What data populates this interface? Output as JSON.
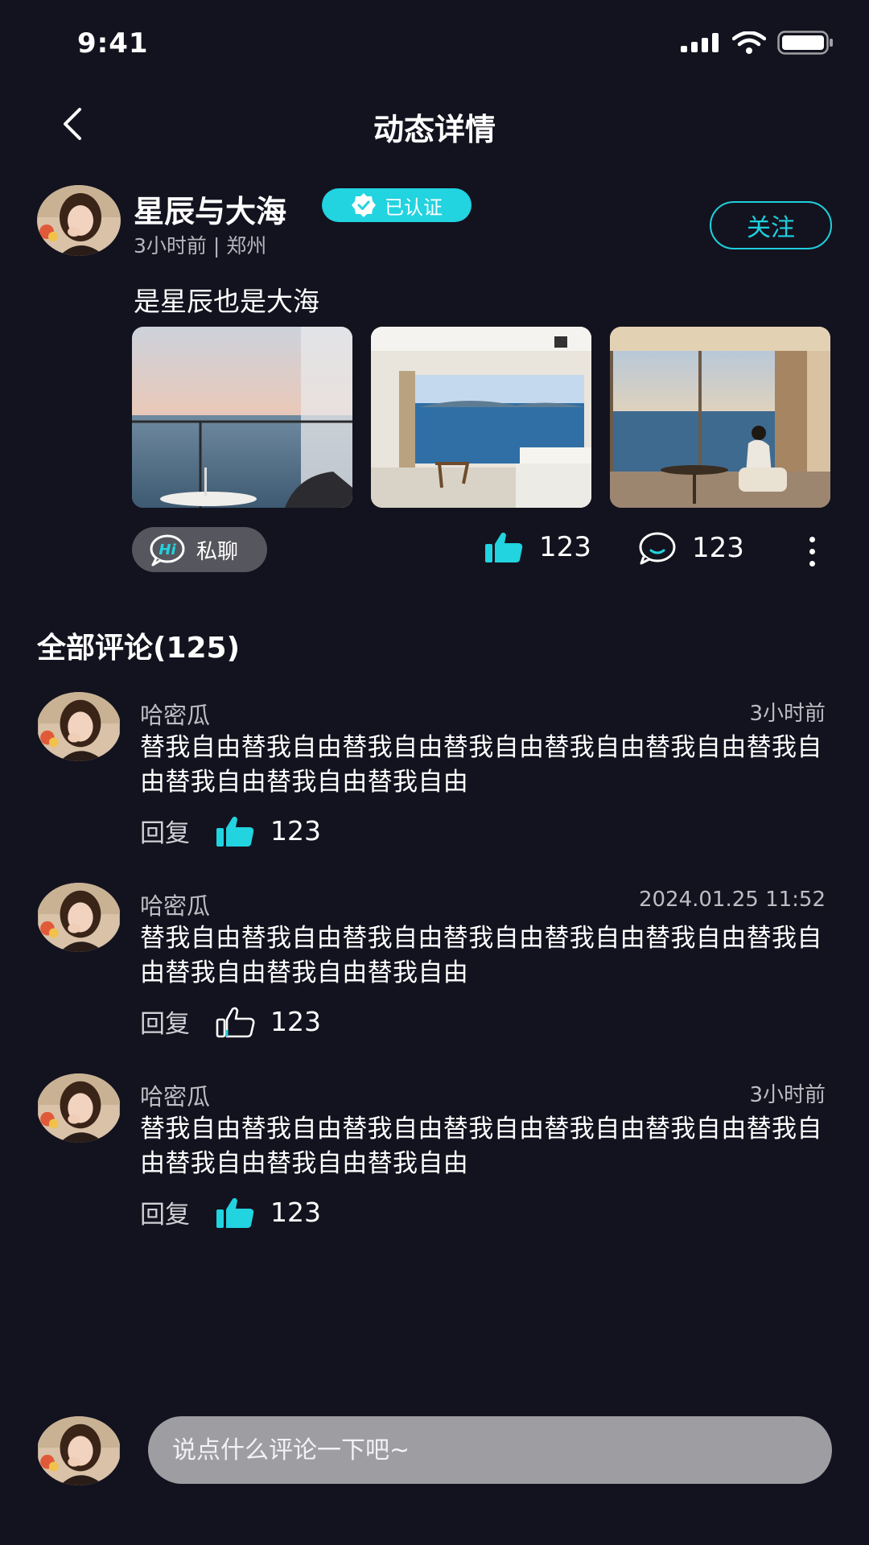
{
  "status_bar": {
    "time": "9:41"
  },
  "nav": {
    "title": "动态详情"
  },
  "post": {
    "author": "星辰与大海",
    "verified_label": "已认证",
    "meta": "3小时前 | 郑州",
    "follow_label": "关注",
    "text": "是星辰也是大海",
    "private_chat_label": "私聊",
    "like_count": "123",
    "comment_count": "123"
  },
  "comments_section": {
    "heading": "全部评论(125)",
    "comments": [
      {
        "author": "哈密瓜",
        "time": "3小时前",
        "text": "替我自由替我自由替我自由替我自由替我自由替我自由替我自由替我自由替我自由替我自由",
        "reply_label": "回复",
        "like_count": "123",
        "liked": true
      },
      {
        "author": "哈密瓜",
        "time": "2024.01.25 11:52",
        "text": "替我自由替我自由替我自由替我自由替我自由替我自由替我自由替我自由替我自由替我自由",
        "reply_label": "回复",
        "like_count": "123",
        "liked": false
      },
      {
        "author": "哈密瓜",
        "time": "3小时前",
        "text": "替我自由替我自由替我自由替我自由替我自由替我自由替我自由替我自由替我自由替我自由",
        "reply_label": "回复",
        "like_count": "123",
        "liked": true
      }
    ]
  },
  "composer": {
    "placeholder": "说点什么评论一下吧~"
  },
  "colors": {
    "background": "#13131f",
    "accent": "#22d3e0",
    "input_bg": "#9d9da2"
  },
  "icons": [
    "back-icon",
    "signal-icon",
    "wifi-icon",
    "battery-icon",
    "verified-icon",
    "hi-chat-icon",
    "thumbs-up-icon",
    "comment-icon",
    "more-icon"
  ]
}
